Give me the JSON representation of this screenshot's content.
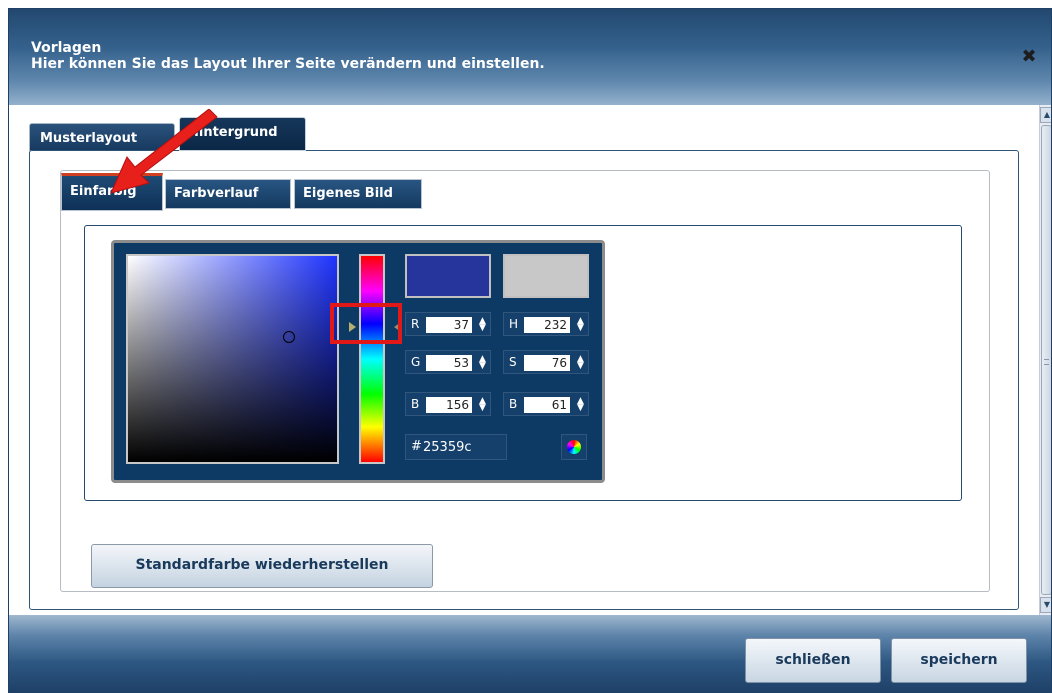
{
  "header": {
    "title": "Vorlagen",
    "subtitle": "Hier können Sie das Layout Ihrer Seite verändern und einstellen.",
    "close_icon": "close-icon"
  },
  "tabs": {
    "musterlayout": "Musterlayout",
    "hintergrund": "Hintergrund"
  },
  "subtabs": {
    "einfarbig": "Einfarbig",
    "farbverlauf": "Farbverlauf",
    "eigenes_bild": "Eigenes Bild"
  },
  "colorpicker": {
    "new_color": "#25359c",
    "old_color": "#c8c8c8",
    "fields": {
      "r_label": "R",
      "r_value": "37",
      "g_label": "G",
      "g_value": "53",
      "b_label": "B",
      "b_value": "156",
      "h_label": "H",
      "h_value": "232",
      "s_label": "S",
      "s_value": "76",
      "br_label": "B",
      "br_value": "61"
    },
    "hex_label": "#",
    "hex_value": "25359c"
  },
  "buttons": {
    "restore": "Standardfarbe wiederherstellen",
    "close": "schließen",
    "save": "speichern"
  },
  "colors": {
    "header_dark": "#22486f",
    "picker_bg": "#0c3a65",
    "highlight": "#e01818",
    "arrow": "#e8201c"
  }
}
